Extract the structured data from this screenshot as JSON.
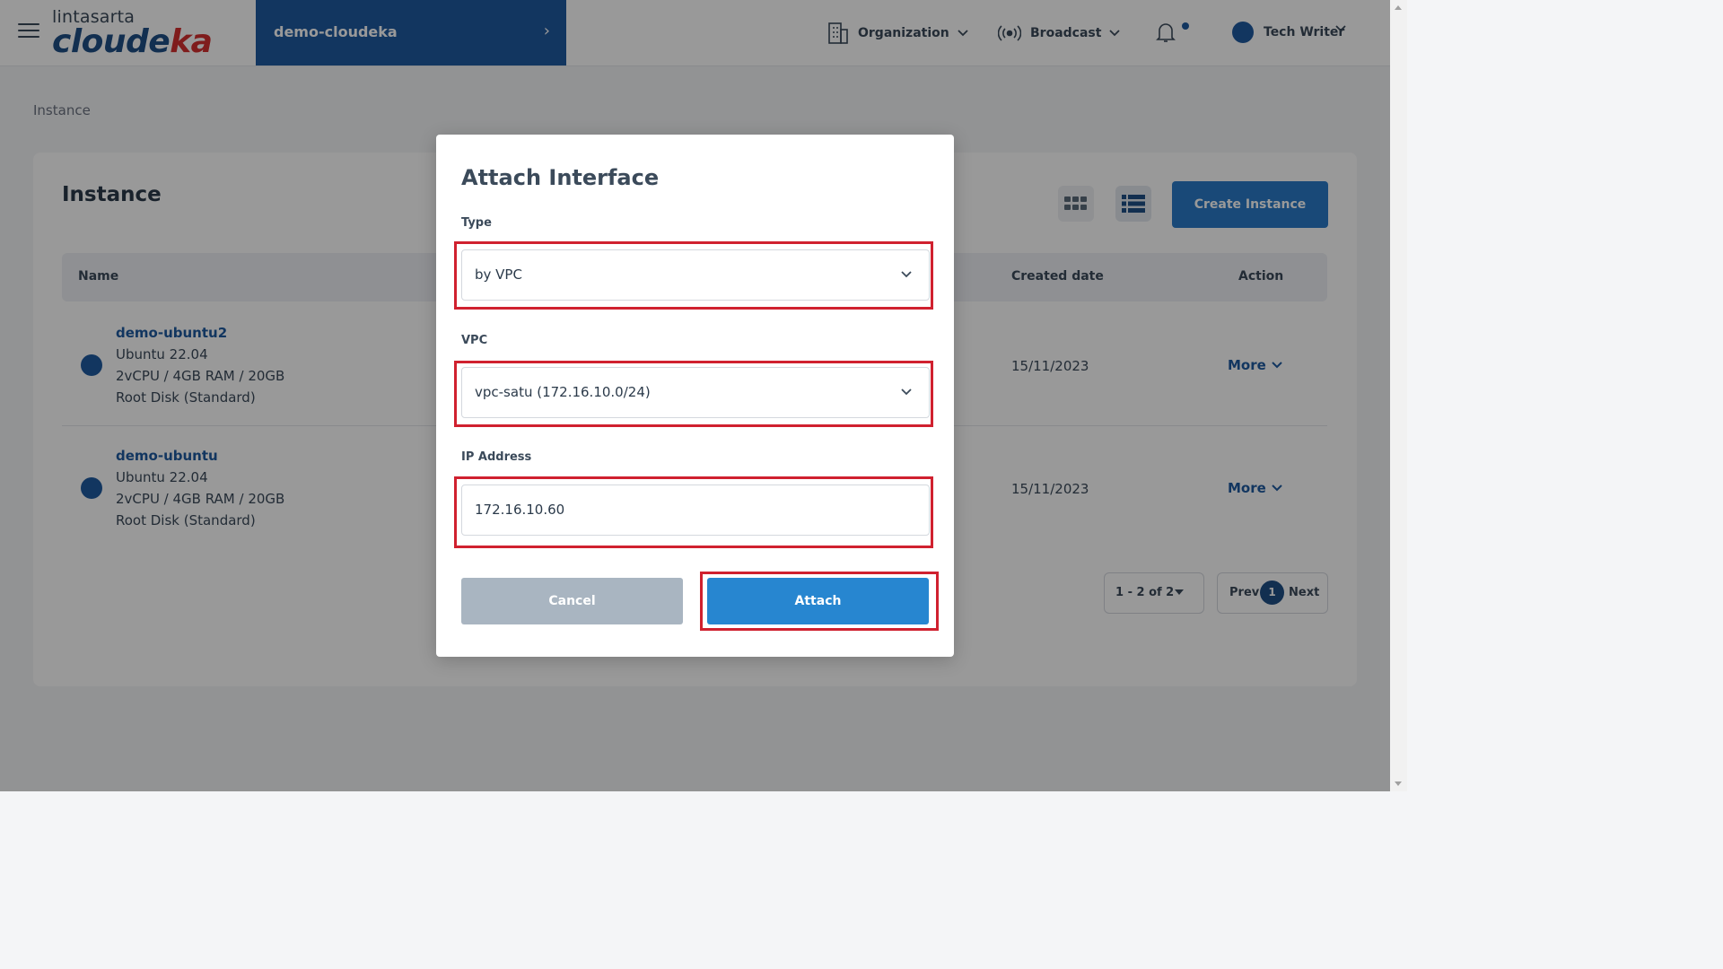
{
  "header": {
    "logo_top": "lintasarta",
    "logo_main_a": "cloude",
    "logo_main_b": "ka",
    "project_name": "demo-cloudeka",
    "organization_label": "Organization",
    "broadcast_label": "Broadcast",
    "user_name": "Tech Writer"
  },
  "breadcrumb": "Instance",
  "page": {
    "title": "Instance",
    "create_button": "Create Instance"
  },
  "table": {
    "columns": {
      "name": "Name",
      "created_date": "Created date",
      "action": "Action"
    },
    "rows": [
      {
        "name": "demo-ubuntu2",
        "os": "Ubuntu 22.04",
        "spec": "2vCPU / 4GB RAM / 20GB",
        "disk": "Root Disk (Standard)",
        "created": "15/11/2023",
        "action": "More"
      },
      {
        "name": "demo-ubuntu",
        "os": "Ubuntu 22.04",
        "spec": "2vCPU / 4GB RAM / 20GB",
        "disk": "Root Disk (Standard)",
        "created": "15/11/2023",
        "action": "More"
      }
    ]
  },
  "pagination": {
    "range": "1 - 2 of 2",
    "prev": "Prev",
    "current": "1",
    "next": "Next"
  },
  "modal": {
    "title": "Attach Interface",
    "type_label": "Type",
    "type_value": "by VPC",
    "vpc_label": "VPC",
    "vpc_value": "vpc-satu (172.16.10.0/24)",
    "ip_label": "IP Address",
    "ip_value": "172.16.10.60",
    "cancel_label": "Cancel",
    "attach_label": "Attach"
  },
  "colors": {
    "brand": "#1f5aa0",
    "primary_button": "#2786d0",
    "highlight": "#d0212f"
  }
}
